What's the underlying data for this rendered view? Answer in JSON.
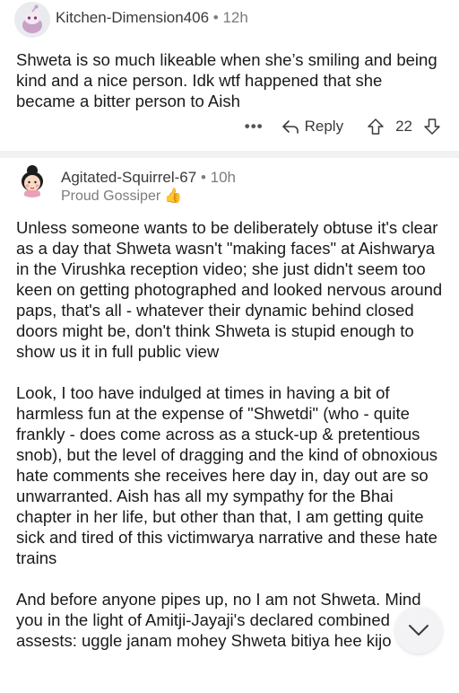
{
  "comments": [
    {
      "username": "Kitchen-Dimension406",
      "time": "12h",
      "body": [
        "Shweta is so much likeable when she’s smiling and being kind and a nice person. Idk wtf happened that she became a bitter person to Aish"
      ],
      "more": "•••",
      "reply_label": "Reply",
      "score": "22"
    },
    {
      "username": "Agitated-Squirrel-67",
      "time": "10h",
      "flair": "Proud Gossiper",
      "flair_emoji": "👍",
      "body": [
        "Unless someone wants to be deliberately obtuse it's clear as a day that Shweta wasn't \"making faces\" at Aishwarya in the Virushka reception video; she just didn't seem too keen on getting photographed and looked nervous around paps, that's all - whatever their dynamic behind closed doors might be, don't think Shweta is stupid enough to show us it in full public view",
        "Look, I too have indulged at times in having a bit of harmless fun at the expense of \"Shwetdi\" (who - quite frankly - does come across as a stuck-up & pretentious snob), but the level of dragging and the kind of obnoxious hate comments she receives here day in, day out are so unwarranted. Aish has all my sympathy for the Bhai chapter in her life, but other than that, I am getting quite sick and tired of this victimwarya narrative and these hate trains",
        "And before anyone pipes up, no I am not Shweta. Mind you in the light of Amitji-Jayaji's declared combined assests: uggle janam mohey Shweta bitiya hee kijo"
      ]
    }
  ],
  "icons": {
    "avatar1": "snoo-avatar-icon",
    "avatar2": "girl-avatar-icon",
    "reply": "reply-arrow-icon",
    "upvote": "upvote-arrow-icon",
    "downvote": "downvote-arrow-icon",
    "scroll": "chevron-down-icon"
  },
  "colors": {
    "divider": "#f1f2f4",
    "meta": "#7c7c7c",
    "text": "#1a1a1b"
  }
}
